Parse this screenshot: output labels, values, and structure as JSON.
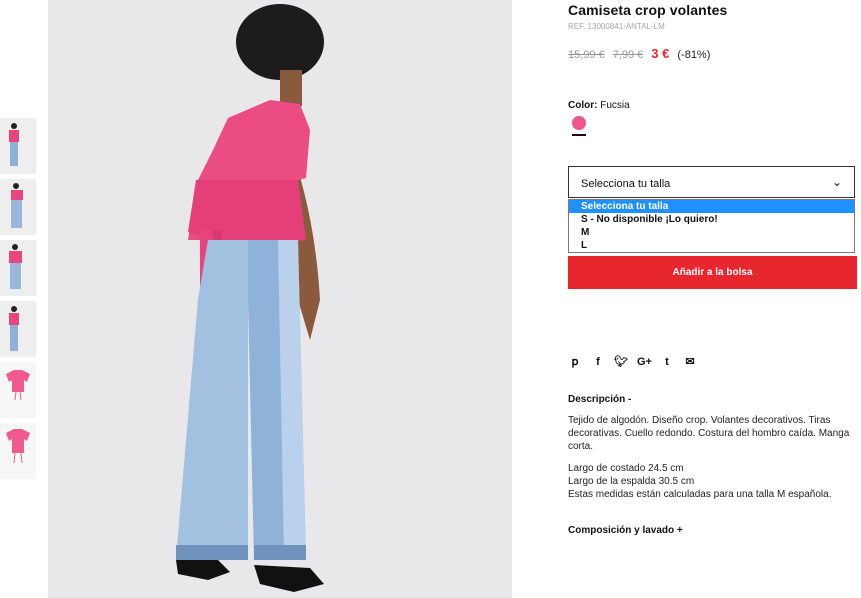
{
  "product": {
    "title": "Camiseta crop volantes",
    "ref": "REF. 13000841-ANTAL-LM",
    "price_original": "15,99 €",
    "price_previous": "7,99 €",
    "price_current": "3 €",
    "discount": "(-81%)"
  },
  "color": {
    "label": "Color:",
    "value": "Fucsia",
    "swatch": "#f0558c"
  },
  "size_select": {
    "current": "Selecciona tu talla",
    "options": [
      "Selecciona tu talla",
      "S - No disponible ¡Lo quiero!",
      "M",
      "L"
    ]
  },
  "add_button": {
    "label": "Añadir a la bolsa",
    "color": "#e8262e"
  },
  "share_icons": [
    "pinterest-icon",
    "facebook-icon",
    "twitter-icon",
    "google-plus-icon",
    "tumblr-icon",
    "email-icon"
  ],
  "description": {
    "title": "Descripción -",
    "text": "Tejido de algodón. Diseño crop. Volantes decorativos. Tiras decorativas. Cuello redondo. Costura del hombro caída. Manga corta.",
    "measure_1": "Largo de costado 24.5 cm",
    "measure_2": "Largo de la espalda 30.5 cm",
    "measure_3": "Estas medidas están calculadas para una talla M española."
  },
  "composition": {
    "title": "Composición y lavado +"
  }
}
